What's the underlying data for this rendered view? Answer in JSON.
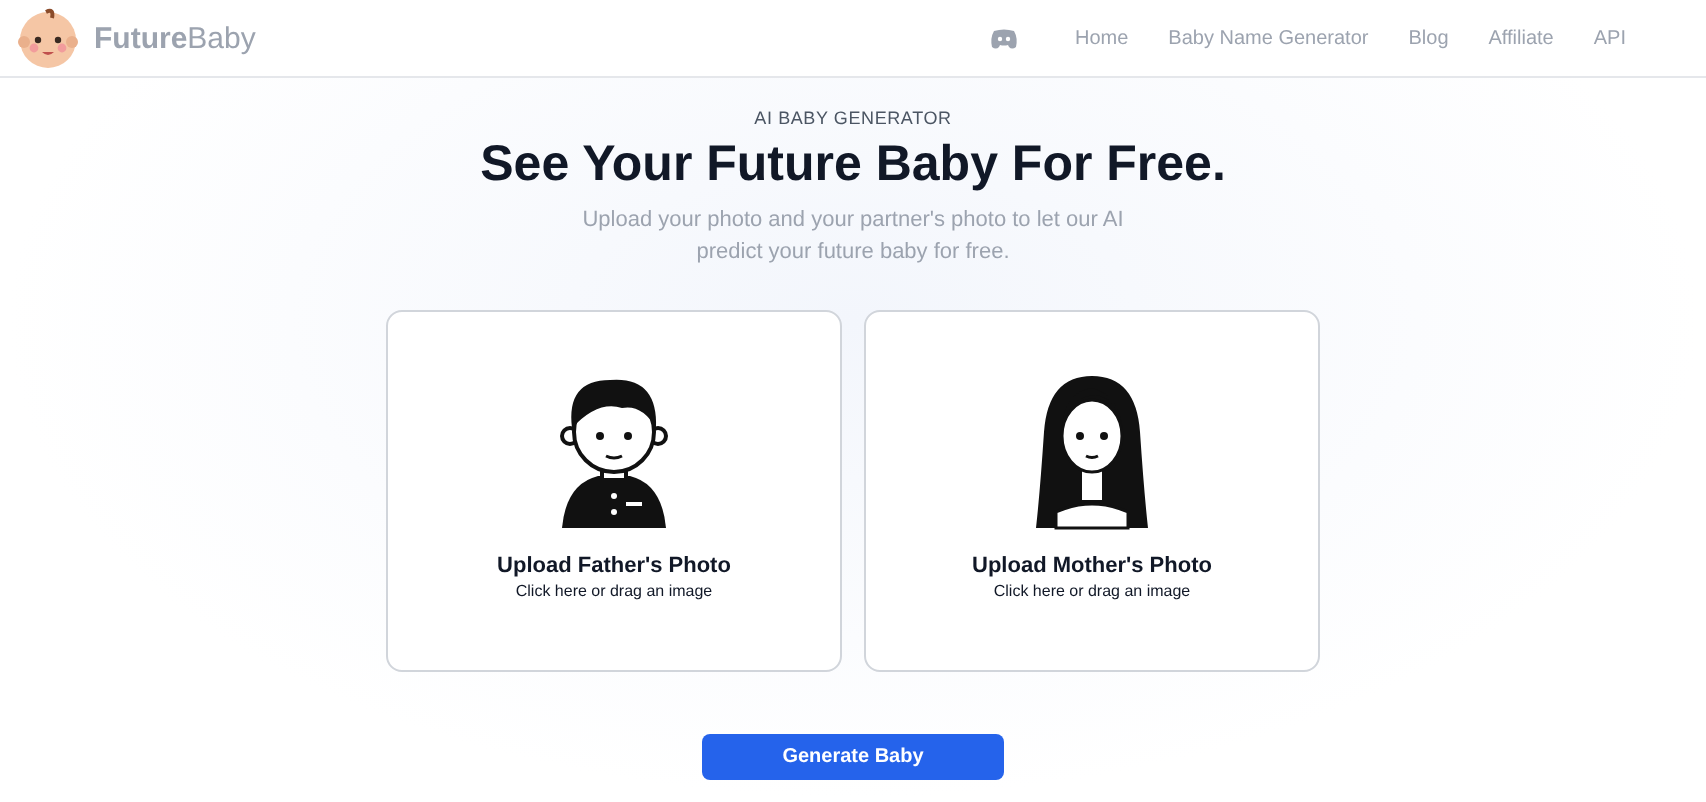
{
  "header": {
    "logo": "**Future**Baby",
    "nav": [
      "Home",
      "Baby Name Generator",
      "Blog",
      "Affiliate",
      "API"
    ]
  },
  "hero": {
    "eyebrow": "AI BABY GENERATOR",
    "title": "See Your Future Baby For Free.",
    "subtitle": "Upload your photo and your partner's photo to let our AI predict your future baby for free."
  },
  "uploads": [
    {
      "kind": "father",
      "title": "Upload Father's Photo",
      "hint": "Click here or drag an image"
    },
    {
      "kind": "mother",
      "title": "Upload Mother's Photo",
      "hint": "Click here or drag an image"
    }
  ],
  "button": "Generate Baby"
}
